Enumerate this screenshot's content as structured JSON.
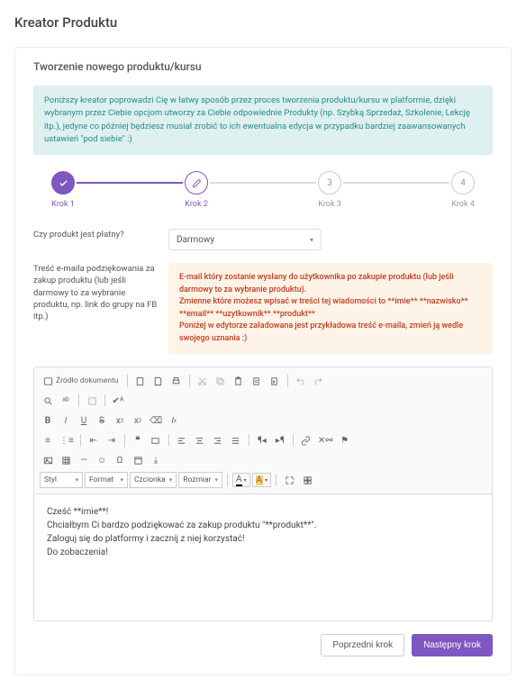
{
  "page_title": "Kreator Produktu",
  "subtitle": "Tworzenie nowego produktu/kursu",
  "info_text": "Poniższy kreator poprowadzi Cię w łatwy sposób przez proces tworzenia produktu/kursu w platformie, dzięki wybranym przez Ciebie opcjom utworzy za Ciebie odpowiednie Produkty (np. Szybką Sprzedaż, Szkolenie, Lekcję itp.), jedyne co później będziesz musiał zrobić to ich ewentualna edycja w przypadku bardziej zaawansowanych ustawień \"pod siebie\" :)",
  "steps": {
    "s1": {
      "label": "Krok 1"
    },
    "s2": {
      "label": "Krok 2"
    },
    "s3": {
      "label": "Krok 3",
      "num": "3"
    },
    "s4": {
      "label": "Krok 4",
      "num": "4"
    }
  },
  "field_paid": {
    "label": "Czy produkt jest płatny?",
    "value": "Darmowy"
  },
  "field_email": {
    "label": "Treść e-maila podziękowania za zakup produktu (lub jeśli darmowy to za wybranie produktu, np. link do grupy na FB itp.)",
    "warn_line1": "E-mail który zostanie wysłany do użytkownika po zakupie produktu (lub jeśli darmowy to za wybranie produktu).",
    "warn_line2": "Zmienne które możesz wpisać w treści tej wiadomości to **imie** **nazwisko** **email** **uzytkownik** **produkt**",
    "warn_line3": "Poniżej w edytorze załadowana jest przykładowa treść e-maila, zmień ją wedle swojego uznania :)"
  },
  "editor": {
    "source_label": "Źródło dokumentu",
    "style_label": "Styl",
    "format_label": "Format",
    "font_label": "Czcionka",
    "size_label": "Rozmiar",
    "content_l1": "Cześć **imie**!",
    "content_l2": "Chciałbym Ci bardzo podziękować za zakup produktu \"**produkt**\".",
    "content_l3": "Zaloguj się do platformy i zacznij z niej korzystać!",
    "content_l4": "Do zobaczenia!"
  },
  "buttons": {
    "prev": "Poprzedni krok",
    "next": "Następny krok"
  }
}
